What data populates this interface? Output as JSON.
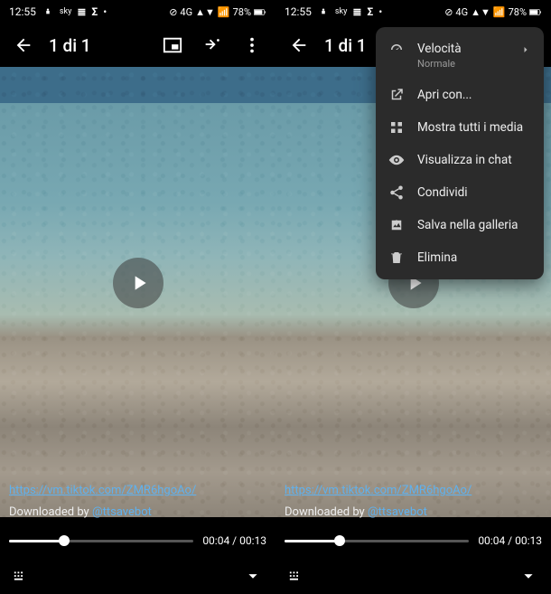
{
  "status": {
    "time": "12:55",
    "battery": "78%",
    "net": "4G"
  },
  "header": {
    "counter": "1 di 1"
  },
  "overlay": {
    "link": "https://vm.tiktok.com/ZMR6hgoAo/",
    "downloaded_prefix": "Downloaded by ",
    "handle": "@ttsavebot"
  },
  "player": {
    "elapsed": "00:04",
    "duration": "00:13",
    "progress_pct": 30
  },
  "menu": {
    "speed_label": "Velocità",
    "speed_value": "Normale",
    "open_with": "Apri con...",
    "show_all_media": "Mostra tutti i media",
    "view_in_chat": "Visualizza in chat",
    "share": "Condividi",
    "save_gallery": "Salva nella galleria",
    "delete": "Elimina"
  }
}
